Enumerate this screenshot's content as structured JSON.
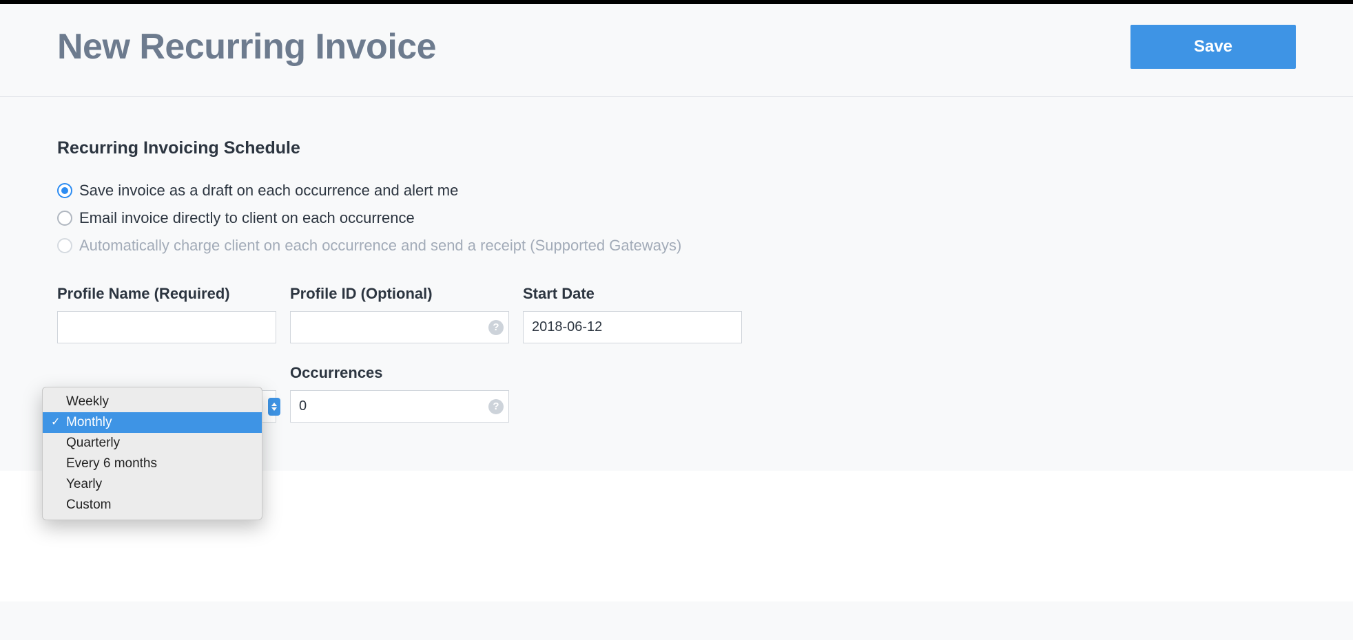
{
  "header": {
    "title": "New Recurring Invoice",
    "save_label": "Save"
  },
  "schedule": {
    "section_title": "Recurring Invoicing Schedule",
    "radios": {
      "draft": {
        "label": "Save invoice as a draft on each occurrence and alert me",
        "checked": true,
        "disabled": false
      },
      "email": {
        "label": "Email invoice directly to client on each occurrence",
        "checked": false,
        "disabled": false
      },
      "charge": {
        "label": "Automatically charge client on each occurrence and send a receipt (Supported Gateways)",
        "checked": false,
        "disabled": true
      }
    },
    "fields": {
      "profile_name": {
        "label": "Profile Name (Required)",
        "value": ""
      },
      "profile_id": {
        "label": "Profile ID (Optional)",
        "value": ""
      },
      "start_date": {
        "label": "Start Date",
        "value": "2018-06-12"
      },
      "occurrences": {
        "label": "Occurrences",
        "value": "0"
      }
    },
    "frequency_dropdown": {
      "selected": "Monthly",
      "options": [
        "Weekly",
        "Monthly",
        "Quarterly",
        "Every 6 months",
        "Yearly",
        "Custom"
      ]
    }
  }
}
